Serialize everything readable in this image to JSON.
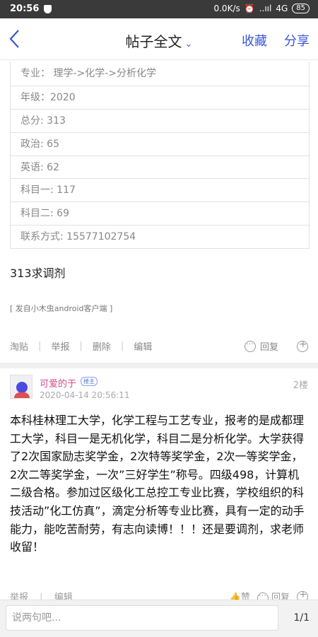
{
  "status_bar": {
    "time": "20:56",
    "network": "0.0K/s",
    "signal": "..ııl",
    "wifi": "4G",
    "battery": "85"
  },
  "nav": {
    "title": "帖子全文",
    "favorite": "收藏",
    "share": "分享"
  },
  "info_table": [
    {
      "label": "专业：  理学->化学->分析化学"
    },
    {
      "label": "年级：2020"
    },
    {
      "label": "总分: 313"
    },
    {
      "label": "政治: 65"
    },
    {
      "label": "英语: 62"
    },
    {
      "label": "科目一: 117"
    },
    {
      "label": "科目二: 69"
    },
    {
      "label": "联系方式: 15577102754"
    }
  ],
  "post": {
    "text": "313求调剂",
    "client": "[ 发自小木虫android客户端 ]"
  },
  "post_actions": {
    "tao": "淘贴",
    "report": "举报",
    "delete": "删除",
    "edit": "编辑",
    "reply": "回复"
  },
  "reply": {
    "username": "可爱的于",
    "badge": "楼主",
    "time": "2020-04-14 20:56:11",
    "floor": "2楼",
    "content": "本科桂林理工大学，化学工程与工艺专业，报考的是成都理工大学，科目一是无机化学，科目二是分析化学。大学获得了2次国家励志奖学金，2次特等奖学金，2次一等奖学金，2次二等奖学金，一次”三好学生”称号。四级498，计算机二级合格。参加过区级化工总控工专业比赛，学校组织的科技活动”化工仿真”，滴定分析等专业比赛，具有一定的动手能力，能吃苦耐劳，有志向读博！！！还是要调剂，求老师收留！"
  },
  "reply_actions": {
    "report": "举报",
    "edit": "编辑",
    "like": "赞",
    "reply": "回复"
  },
  "bottom_bar": {
    "placeholder": "说两句吧...",
    "pager": "1/1"
  }
}
